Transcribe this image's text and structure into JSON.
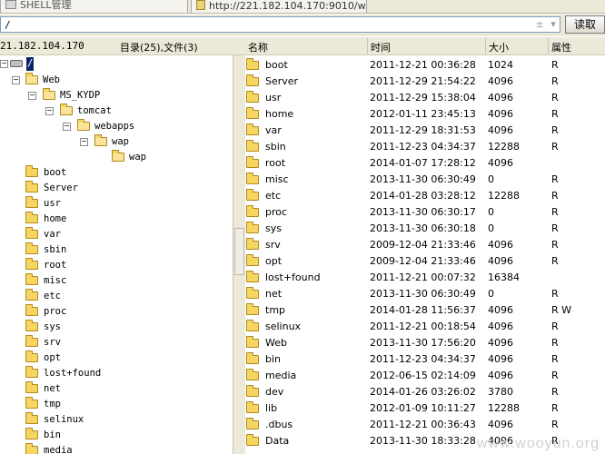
{
  "tabs": [
    {
      "label": "SHELL管理"
    },
    {
      "label": "http://221.182.104.170:9010/w..."
    }
  ],
  "address": {
    "value": "/",
    "read_label": "读取"
  },
  "header": {
    "ip": "21.182.104.170",
    "count": "目录(25),文件(3)",
    "col_name": "名称",
    "col_time": "时间",
    "col_size": "大小",
    "col_attr": "属性"
  },
  "tree": {
    "root": "/",
    "path_nodes": [
      "Web",
      "MS_KYDP",
      "tomcat",
      "webapps",
      "wap",
      "wap"
    ],
    "folders": [
      "boot",
      "Server",
      "usr",
      "home",
      "var",
      "sbin",
      "root",
      "misc",
      "etc",
      "proc",
      "sys",
      "srv",
      "opt",
      "lost+found",
      "net",
      "tmp",
      "selinux",
      "bin",
      "media"
    ]
  },
  "files": [
    {
      "name": "boot",
      "time": "2011-12-21 00:36:28",
      "size": "1024",
      "attr": "R"
    },
    {
      "name": "Server",
      "time": "2011-12-29 21:54:22",
      "size": "4096",
      "attr": "R"
    },
    {
      "name": "usr",
      "time": "2011-12-29 15:38:04",
      "size": "4096",
      "attr": "R"
    },
    {
      "name": "home",
      "time": "2012-01-11 23:45:13",
      "size": "4096",
      "attr": "R"
    },
    {
      "name": "var",
      "time": "2011-12-29 18:31:53",
      "size": "4096",
      "attr": "R"
    },
    {
      "name": "sbin",
      "time": "2011-12-23 04:34:37",
      "size": "12288",
      "attr": "R"
    },
    {
      "name": "root",
      "time": "2014-01-07 17:28:12",
      "size": "4096",
      "attr": ""
    },
    {
      "name": "misc",
      "time": "2013-11-30 06:30:49",
      "size": "0",
      "attr": "R"
    },
    {
      "name": "etc",
      "time": "2014-01-28 03:28:12",
      "size": "12288",
      "attr": "R"
    },
    {
      "name": "proc",
      "time": "2013-11-30 06:30:17",
      "size": "0",
      "attr": "R"
    },
    {
      "name": "sys",
      "time": "2013-11-30 06:30:18",
      "size": "0",
      "attr": "R"
    },
    {
      "name": "srv",
      "time": "2009-12-04 21:33:46",
      "size": "4096",
      "attr": "R"
    },
    {
      "name": "opt",
      "time": "2009-12-04 21:33:46",
      "size": "4096",
      "attr": "R"
    },
    {
      "name": "lost+found",
      "time": "2011-12-21 00:07:32",
      "size": "16384",
      "attr": ""
    },
    {
      "name": "net",
      "time": "2013-11-30 06:30:49",
      "size": "0",
      "attr": "R"
    },
    {
      "name": "tmp",
      "time": "2014-01-28 11:56:37",
      "size": "4096",
      "attr": "R W"
    },
    {
      "name": "selinux",
      "time": "2011-12-21 00:18:54",
      "size": "4096",
      "attr": "R"
    },
    {
      "name": "Web",
      "time": "2013-11-30 17:56:20",
      "size": "4096",
      "attr": "R"
    },
    {
      "name": "bin",
      "time": "2011-12-23 04:34:37",
      "size": "4096",
      "attr": "R"
    },
    {
      "name": "media",
      "time": "2012-06-15 02:14:09",
      "size": "4096",
      "attr": "R"
    },
    {
      "name": "dev",
      "time": "2014-01-26 03:26:02",
      "size": "3780",
      "attr": "R"
    },
    {
      "name": "lib",
      "time": "2012-01-09 10:11:27",
      "size": "12288",
      "attr": "R"
    },
    {
      "name": ".dbus",
      "time": "2011-12-21 00:36:43",
      "size": "4096",
      "attr": "R"
    },
    {
      "name": "Data",
      "time": "2013-11-30 18:33:28",
      "size": "4096",
      "attr": "R"
    }
  ],
  "watermark": "www.wooyun.org"
}
